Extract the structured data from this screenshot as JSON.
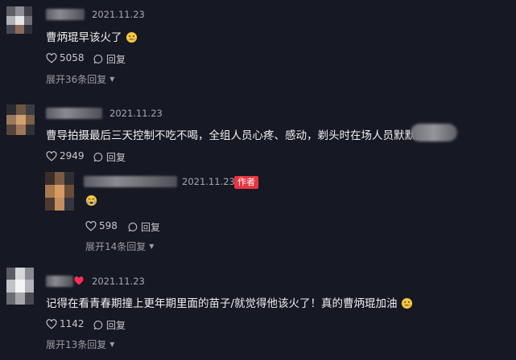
{
  "comments": [
    {
      "date": "2021.11.23",
      "text": "曹炳琨早该火了",
      "likes": "5058",
      "reply_label": "回复",
      "more_replies": "展开36条回复"
    },
    {
      "date": "2021.11.23",
      "text": "曹导拍摄最后三天控制不吃不喝，全组人员心疼、感动，剃头时在场人员默默落泪",
      "likes": "2949",
      "reply_label": "回复",
      "reply": {
        "date": "2021.11.23",
        "author_badge": "作者",
        "likes": "598",
        "reply_label": "回复",
        "more_replies": "展开14条回复"
      }
    },
    {
      "date": "2021.11.23",
      "text": "记得在看青春期撞上更年期里面的苗子/就觉得他该火了！真的曹炳琨加油",
      "likes": "1142",
      "reply_label": "回复",
      "more_replies": "展开13条回复"
    }
  ],
  "colors": {
    "background": "#161823",
    "author_badge": "#e8353f",
    "heart_red": "#fe2c55"
  }
}
